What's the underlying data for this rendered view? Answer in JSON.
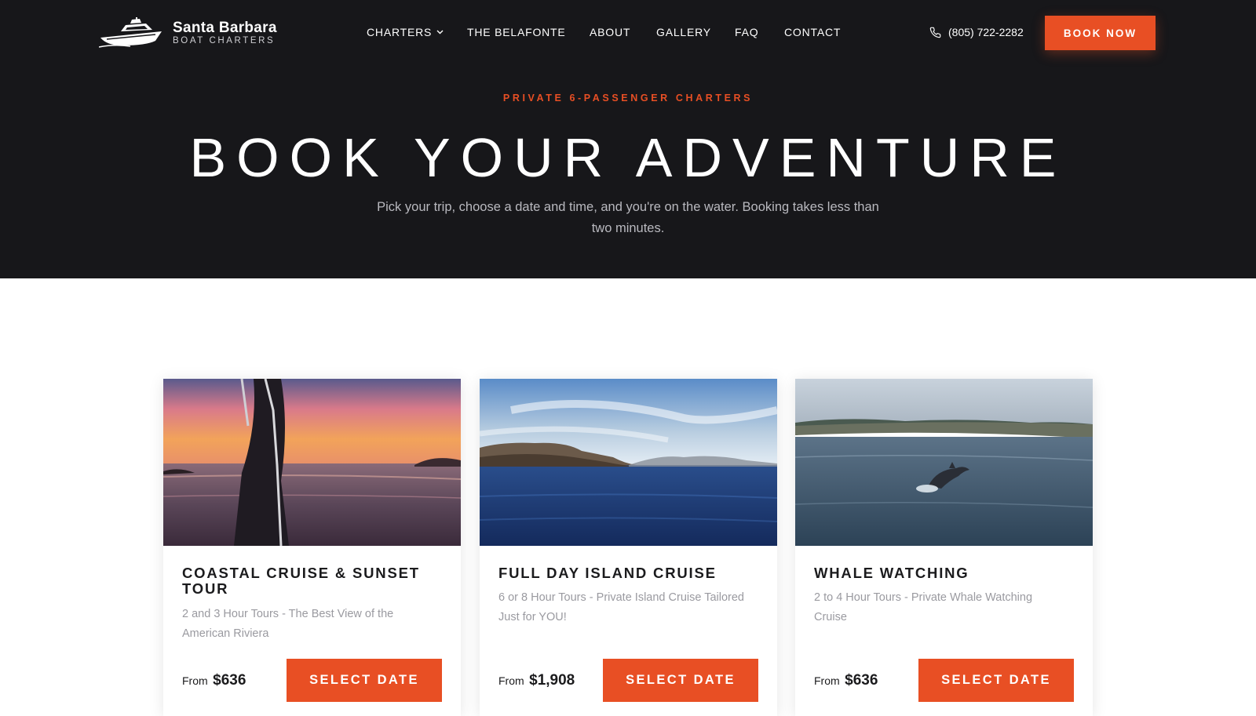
{
  "brand": {
    "name": "Santa Barbara",
    "tagline": "BOAT CHARTERS"
  },
  "nav": {
    "items": [
      {
        "label": "CHARTERS"
      },
      {
        "label": "THE BELAFONTE"
      },
      {
        "label": "ABOUT"
      },
      {
        "label": "GALLERY"
      },
      {
        "label": "FAQ"
      },
      {
        "label": "CONTACT"
      }
    ],
    "phone": "(805) 722-2282",
    "cta": "BOOK NOW"
  },
  "hero": {
    "eyebrow": "PRIVATE 6-PASSENGER CHARTERS",
    "title": "BOOK YOUR ADVENTURE",
    "subtitle": "Pick your trip, choose a date and time, and you're on the water. Booking takes less than two minutes."
  },
  "tours": [
    {
      "title": "COASTAL CRUISE & SUNSET TOUR",
      "description": "2 and 3 Hour Tours - The Best View of the American Riviera",
      "price_prefix": "From",
      "price": "$636",
      "button": "SELECT DATE"
    },
    {
      "title": "FULL DAY ISLAND CRUISE",
      "description": "6 or 8 Hour Tours - Private Island Cruise Tailored Just for YOU!",
      "price_prefix": "From",
      "price": "$1,908",
      "button": "SELECT DATE"
    },
    {
      "title": "WHALE WATCHING",
      "description": "2 to 4 Hour Tours - Private Whale Watching Cruise",
      "price_prefix": "From",
      "price": "$636",
      "button": "SELECT DATE"
    }
  ],
  "colors": {
    "accent": "#e84f24",
    "hero_bg": "#17171a",
    "muted_text": "#9a9aa0"
  },
  "icons": [
    "boat-logo-icon",
    "chevron-down-icon",
    "phone-icon"
  ]
}
